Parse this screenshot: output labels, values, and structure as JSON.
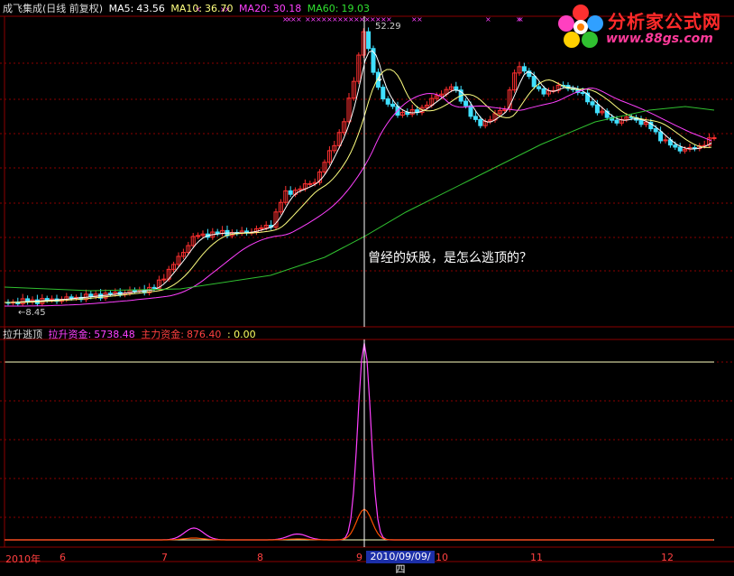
{
  "main_panel": {
    "stock_name": "成飞集成(日线 前复权)",
    "ma5_label": "MA5:",
    "ma5_value": "43.56",
    "ma10_label": "MA10:",
    "ma10_value": "36.70",
    "ma20_label": "MA20:",
    "ma20_value": "30.18",
    "ma60_label": "MA60:",
    "ma60_value": "19.03",
    "high_label": "52.29",
    "low_label": "←8.45",
    "annotation": "曾经的妖股，是怎么逃顶的？"
  },
  "indicator_panel": {
    "name": "拉升逃顶",
    "lift_label": "拉升资金:",
    "lift_value": "5738.48",
    "main_label": "主力资金:",
    "main_value": "876.40",
    "extra_value": ": 0.00"
  },
  "time_axis": {
    "ticks": [
      "2010年",
      "6",
      "7",
      "8",
      "9",
      "10",
      "11",
      "12"
    ],
    "cursor_date": "2010/09/09/四"
  },
  "logo": {
    "title": "分析家公式网",
    "url": "www.88gs.com"
  },
  "colors": {
    "up": "#ff3030",
    "down": "#40e0ff",
    "ma5": "#ffffff",
    "ma10": "#ffff80",
    "ma20": "#ff40ff",
    "ma60": "#30c030",
    "grid": "#8b0000",
    "lift": "#ff40ff",
    "main": "#ff5000"
  }
}
